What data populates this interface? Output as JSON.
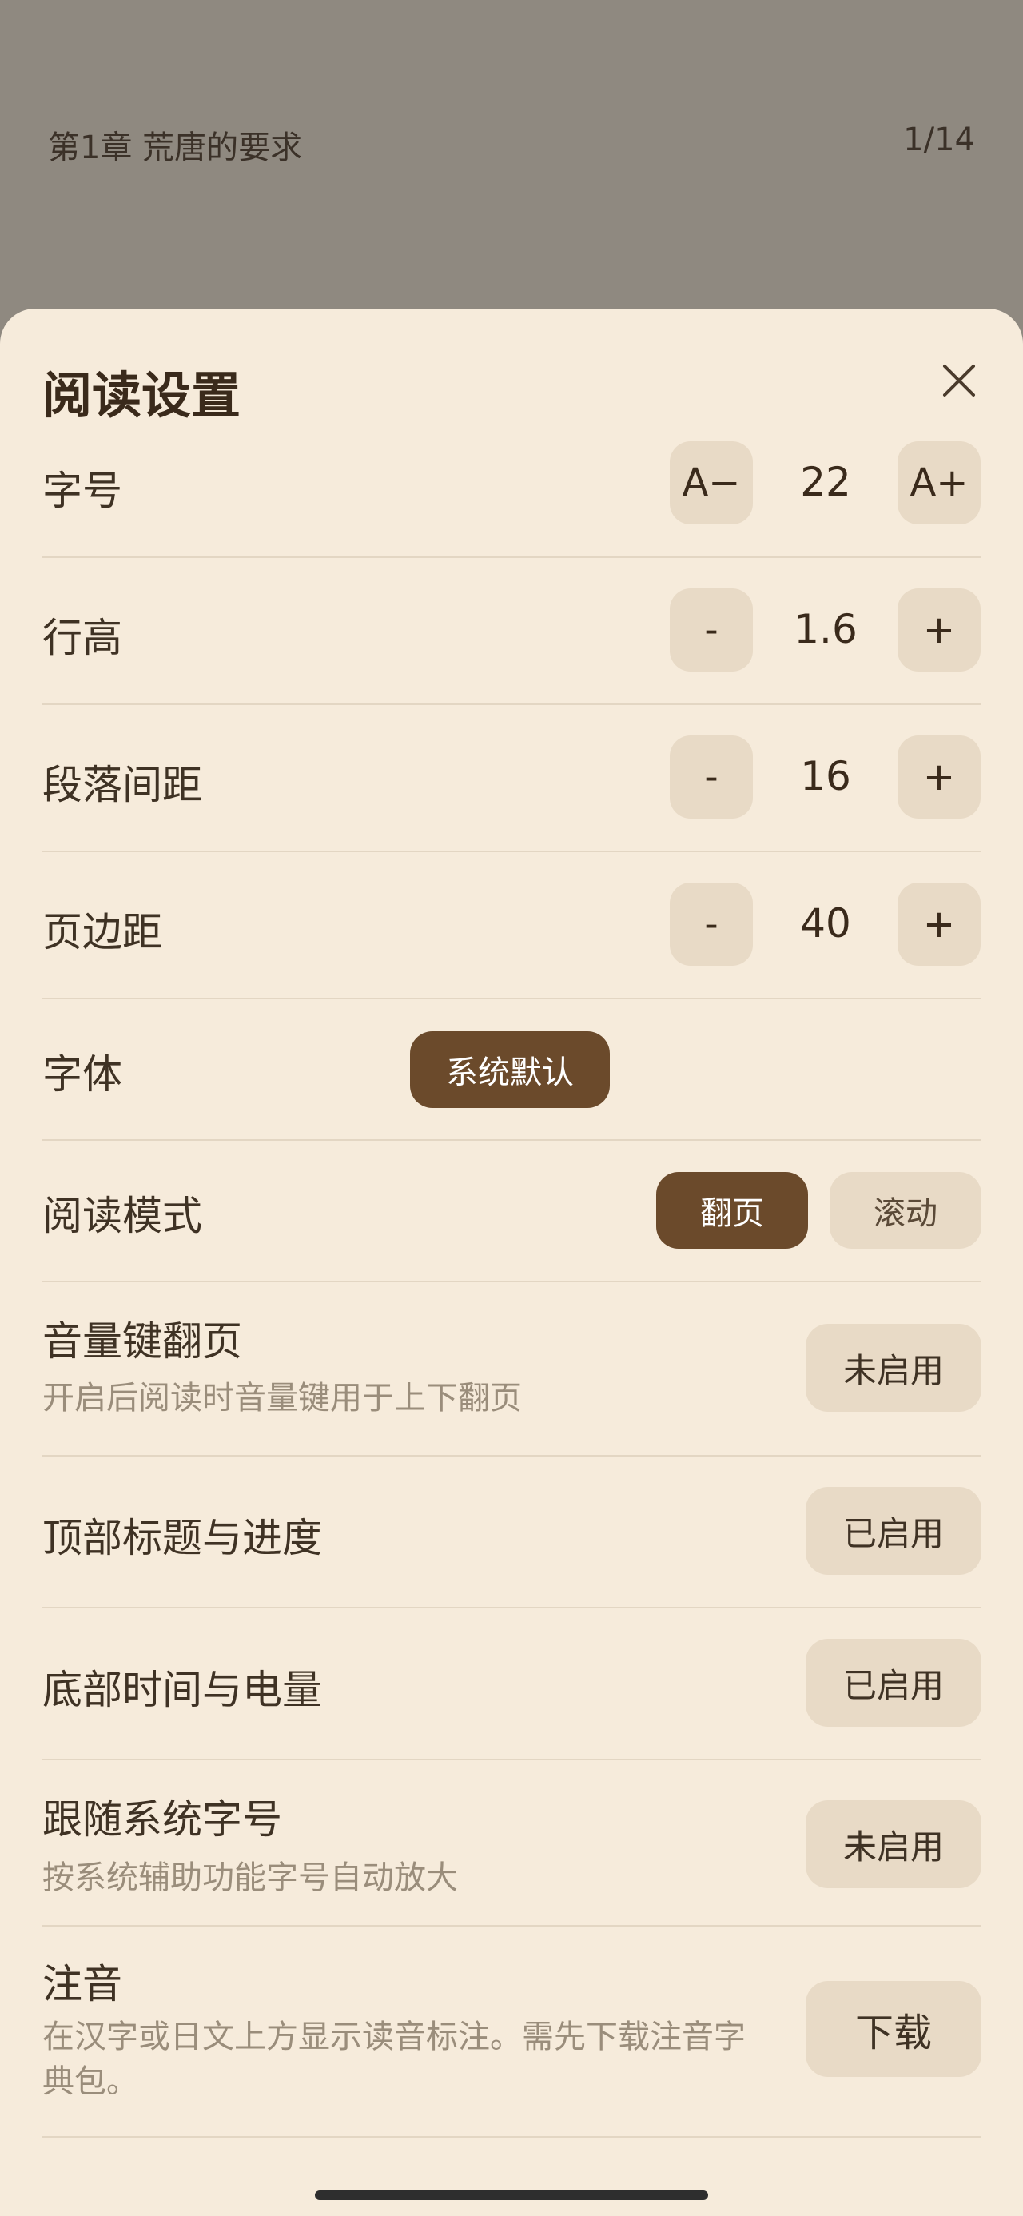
{
  "reader": {
    "chapter_title": "第1章 荒唐的要求",
    "page_indicator": "1/14"
  },
  "settings": {
    "title": "阅读设置",
    "font_size": {
      "label": "字号",
      "decrease": "A−",
      "value": "22",
      "increase": "A+"
    },
    "line_height": {
      "label": "行高",
      "decrease": "-",
      "value": "1.6",
      "increase": "+"
    },
    "paragraph_spacing": {
      "label": "段落间距",
      "decrease": "-",
      "value": "16",
      "increase": "+"
    },
    "page_margin": {
      "label": "页边距",
      "decrease": "-",
      "value": "40",
      "increase": "+"
    },
    "font": {
      "label": "字体",
      "selected": "系统默认"
    },
    "reading_mode": {
      "label": "阅读模式",
      "options": [
        "翻页",
        "滚动"
      ],
      "selected": "翻页"
    },
    "volume_key": {
      "label": "音量键翻页",
      "description": "开启后阅读时音量键用于上下翻页",
      "state": "未启用"
    },
    "top_title": {
      "label": "顶部标题与进度",
      "state": "已启用"
    },
    "bottom_time": {
      "label": "底部时间与电量",
      "state": "已启用"
    },
    "follow_system_font": {
      "label": "跟随系统字号",
      "description": "按系统辅助功能字号自动放大",
      "state": "未启用"
    },
    "phonetic": {
      "label": "注音",
      "description": "在汉字或日文上方显示读音标注。需先下载注音字典包。",
      "action": "下载"
    }
  },
  "colors": {
    "accent": "#6b4a2b",
    "sheet_bg": "#f6ebdb",
    "button_bg": "#e8dac6",
    "overlay": "#8f8980"
  },
  "icons": {
    "close": "close-icon"
  }
}
